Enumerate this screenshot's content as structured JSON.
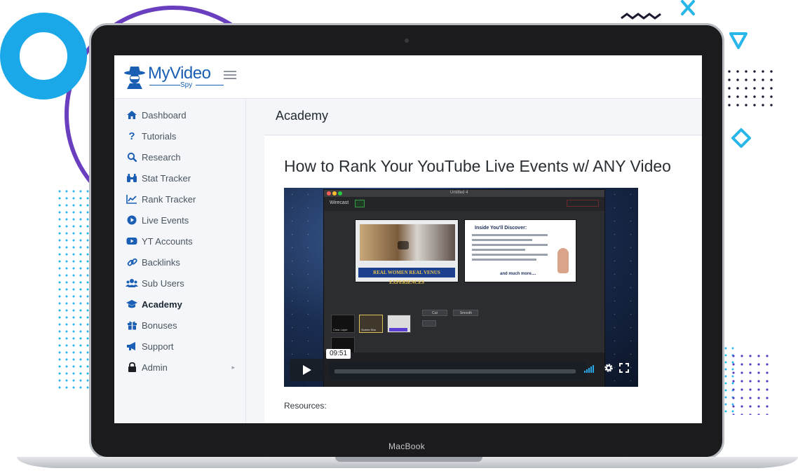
{
  "device": {
    "name": "MacBook"
  },
  "app": {
    "logo_main": "MyVideo",
    "logo_sub": "Spy"
  },
  "sidebar": {
    "items": [
      {
        "label": "Dashboard",
        "icon": "home-icon"
      },
      {
        "label": "Tutorials",
        "icon": "question-icon"
      },
      {
        "label": "Research",
        "icon": "search-icon"
      },
      {
        "label": "Stat Tracker",
        "icon": "binoculars-icon"
      },
      {
        "label": "Rank Tracker",
        "icon": "line-chart-icon"
      },
      {
        "label": "Live Events",
        "icon": "play-circle-icon"
      },
      {
        "label": "YT Accounts",
        "icon": "youtube-icon"
      },
      {
        "label": "Backlinks",
        "icon": "link-icon"
      },
      {
        "label": "Sub Users",
        "icon": "users-icon"
      },
      {
        "label": "Academy",
        "icon": "graduation-cap-icon",
        "active": true
      },
      {
        "label": "Bonuses",
        "icon": "gift-icon"
      },
      {
        "label": "Support",
        "icon": "megaphone-icon"
      },
      {
        "label": "Admin",
        "icon": "lock-icon",
        "has_children": true
      }
    ]
  },
  "main": {
    "page_title": "Academy",
    "video_title": "How to Rank Your YouTube Live Events w/ ANY Video",
    "resources_label": "Resources:"
  },
  "video": {
    "timecode": "09:51",
    "software": {
      "window_title": "Untitled 4",
      "brand": "Wirecast",
      "preview_banner_line1": "REAL WOMEN",
      "preview_banner_line2": "REAL VENUS EXPERIENCES",
      "slide_heading": "Inside You'll Discover:",
      "slide_footer": "and much more....",
      "transition_cut": "Cut",
      "transition_smooth": "Smooth",
      "layer_clear": "Clear Layer",
      "layer_screen": "Screen Sho"
    }
  },
  "colors": {
    "accent": "#1a5fb4",
    "deco_blue": "#1aa8e8",
    "deco_purple": "#6a3fbf"
  }
}
